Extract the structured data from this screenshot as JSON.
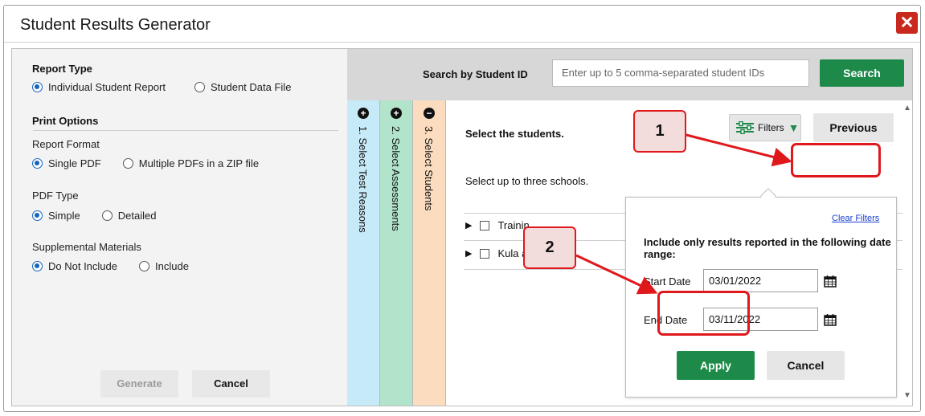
{
  "dialog": {
    "title": "Student Results Generator"
  },
  "left_panel": {
    "report_type_heading": "Report Type",
    "report_type_options": [
      "Individual Student Report",
      "Student Data File"
    ],
    "print_options_heading": "Print Options",
    "report_format_label": "Report Format",
    "report_format_options": [
      "Single PDF",
      "Multiple PDFs in a ZIP file"
    ],
    "pdf_type_label": "PDF Type",
    "pdf_type_options": [
      "Simple",
      "Detailed"
    ],
    "supplemental_label": "Supplemental Materials",
    "supplemental_options": [
      "Do Not Include",
      "Include"
    ],
    "generate_label": "Generate",
    "cancel_label": "Cancel"
  },
  "search": {
    "label": "Search by Student ID",
    "placeholder": "Enter up to 5 comma-separated student IDs",
    "button_label": "Search"
  },
  "steps": [
    {
      "icon": "plus-circle-icon",
      "label": "1. Select Test Reasons",
      "color": "#c6eaf7"
    },
    {
      "icon": "plus-circle-icon",
      "label": "2. Select Assessments",
      "color": "#b2e3cb"
    },
    {
      "icon": "minus-circle-icon",
      "label": "3. Select Students",
      "color": "#fbdcbf"
    }
  ],
  "content": {
    "select_students": "Select the students.",
    "select_schools": "Select up to three schools.",
    "schools": [
      "Trainin",
      "Kula a"
    ],
    "filters_label": "Filters",
    "previous_label": "Previous"
  },
  "filter_popover": {
    "clear_filters": "Clear Filters",
    "description": "Include only results reported in the following date range:",
    "start_date_label": "Start Date",
    "start_date_value": "03/01/2022",
    "end_date_label": "End Date",
    "end_date_value": "03/11/2022",
    "apply_label": "Apply",
    "cancel_label": "Cancel"
  },
  "callouts": [
    "1",
    "2"
  ],
  "colors": {
    "accent_green": "#1e8a4a",
    "close_red": "#c8281e",
    "highlight_red": "#e0181c",
    "radio_blue": "#1565c0"
  }
}
